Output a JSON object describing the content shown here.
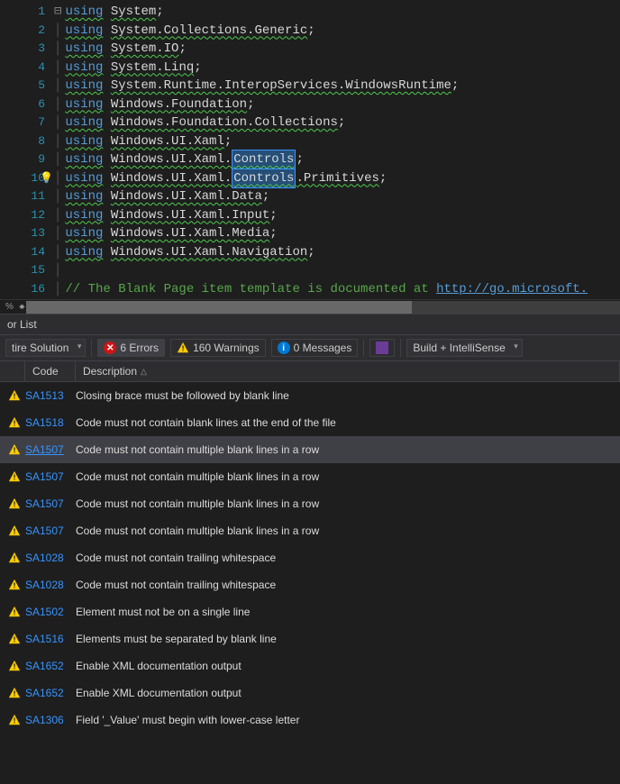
{
  "code": {
    "lines": [
      1,
      2,
      3,
      4,
      5,
      6,
      7,
      8,
      9,
      10,
      11,
      12,
      13,
      14,
      15,
      16
    ],
    "lightbulb_line": 10,
    "source": [
      {
        "using": "using",
        "ns": "System",
        "sel": null,
        "rest": ";"
      },
      {
        "using": "using",
        "ns": "System.Collections.Generic",
        "sel": null,
        "rest": ";"
      },
      {
        "using": "using",
        "ns": "System.IO",
        "sel": null,
        "rest": ";"
      },
      {
        "using": "using",
        "ns": "System.Linq",
        "sel": null,
        "rest": ";"
      },
      {
        "using": "using",
        "ns": "System.Runtime.InteropServices.WindowsRuntime",
        "sel": null,
        "rest": ";"
      },
      {
        "using": "using",
        "ns": "Windows.Foundation",
        "sel": null,
        "rest": ";"
      },
      {
        "using": "using",
        "ns": "Windows.Foundation.Collections",
        "sel": null,
        "rest": ";"
      },
      {
        "using": "using",
        "ns": "Windows.UI.Xaml",
        "sel": null,
        "rest": ";"
      },
      {
        "using": "using",
        "ns": "Windows.UI.Xaml.",
        "sel": "Controls",
        "rest": ";"
      },
      {
        "using": "using",
        "ns": "Windows.UI.Xaml.",
        "sel": "Controls",
        "rest": ".Primitives;"
      },
      {
        "using": "using",
        "ns": "Windows.UI.Xaml.Data",
        "sel": null,
        "rest": ";"
      },
      {
        "using": "using",
        "ns": "Windows.UI.Xaml.Input",
        "sel": null,
        "rest": ";"
      },
      {
        "using": "using",
        "ns": "Windows.UI.Xaml.Media",
        "sel": null,
        "rest": ";"
      },
      {
        "using": "using",
        "ns": "Windows.UI.Xaml.Navigation",
        "sel": null,
        "rest": ";"
      },
      {
        "blank": true
      },
      {
        "comment": "// The Blank Page item template is documented at ",
        "url": "http://go.microsoft."
      }
    ]
  },
  "status": {
    "percent": "%",
    "arrows_tooltip": "scroll"
  },
  "panel": {
    "title": "or List",
    "scope": "tire Solution",
    "errors_label": "6 Errors",
    "warnings_label": "160 Warnings",
    "messages_label": "0 Messages",
    "filter": "Build + IntelliSense"
  },
  "columns": {
    "code": "Code",
    "description": "Description"
  },
  "errors": [
    {
      "icon": "warn",
      "code": "SA1513",
      "link": false,
      "desc": "Closing brace must be followed by blank line",
      "hover": false
    },
    {
      "icon": "warn",
      "code": "SA1518",
      "link": false,
      "desc": "Code must not contain blank lines at the end of the file",
      "hover": false
    },
    {
      "icon": "warn",
      "code": "SA1507",
      "link": true,
      "desc": "Code must not contain multiple blank lines in a row",
      "hover": true
    },
    {
      "icon": "warn",
      "code": "SA1507",
      "link": false,
      "desc": "Code must not contain multiple blank lines in a row",
      "hover": false
    },
    {
      "icon": "warn",
      "code": "SA1507",
      "link": false,
      "desc": "Code must not contain multiple blank lines in a row",
      "hover": false
    },
    {
      "icon": "warn",
      "code": "SA1507",
      "link": false,
      "desc": "Code must not contain multiple blank lines in a row",
      "hover": false
    },
    {
      "icon": "warn",
      "code": "SA1028",
      "link": false,
      "desc": "Code must not contain trailing whitespace",
      "hover": false
    },
    {
      "icon": "warn",
      "code": "SA1028",
      "link": false,
      "desc": "Code must not contain trailing whitespace",
      "hover": false
    },
    {
      "icon": "warn",
      "code": "SA1502",
      "link": false,
      "desc": "Element must not be on a single line",
      "hover": false
    },
    {
      "icon": "warn",
      "code": "SA1516",
      "link": false,
      "desc": "Elements must be separated by blank line",
      "hover": false
    },
    {
      "icon": "warn",
      "code": "SA1652",
      "link": false,
      "desc": "Enable XML documentation output",
      "hover": false
    },
    {
      "icon": "warn",
      "code": "SA1652",
      "link": false,
      "desc": "Enable XML documentation output",
      "hover": false
    },
    {
      "icon": "warn",
      "code": "SA1306",
      "link": false,
      "desc": "Field '_Value' must begin with lower-case letter",
      "hover": false
    }
  ]
}
